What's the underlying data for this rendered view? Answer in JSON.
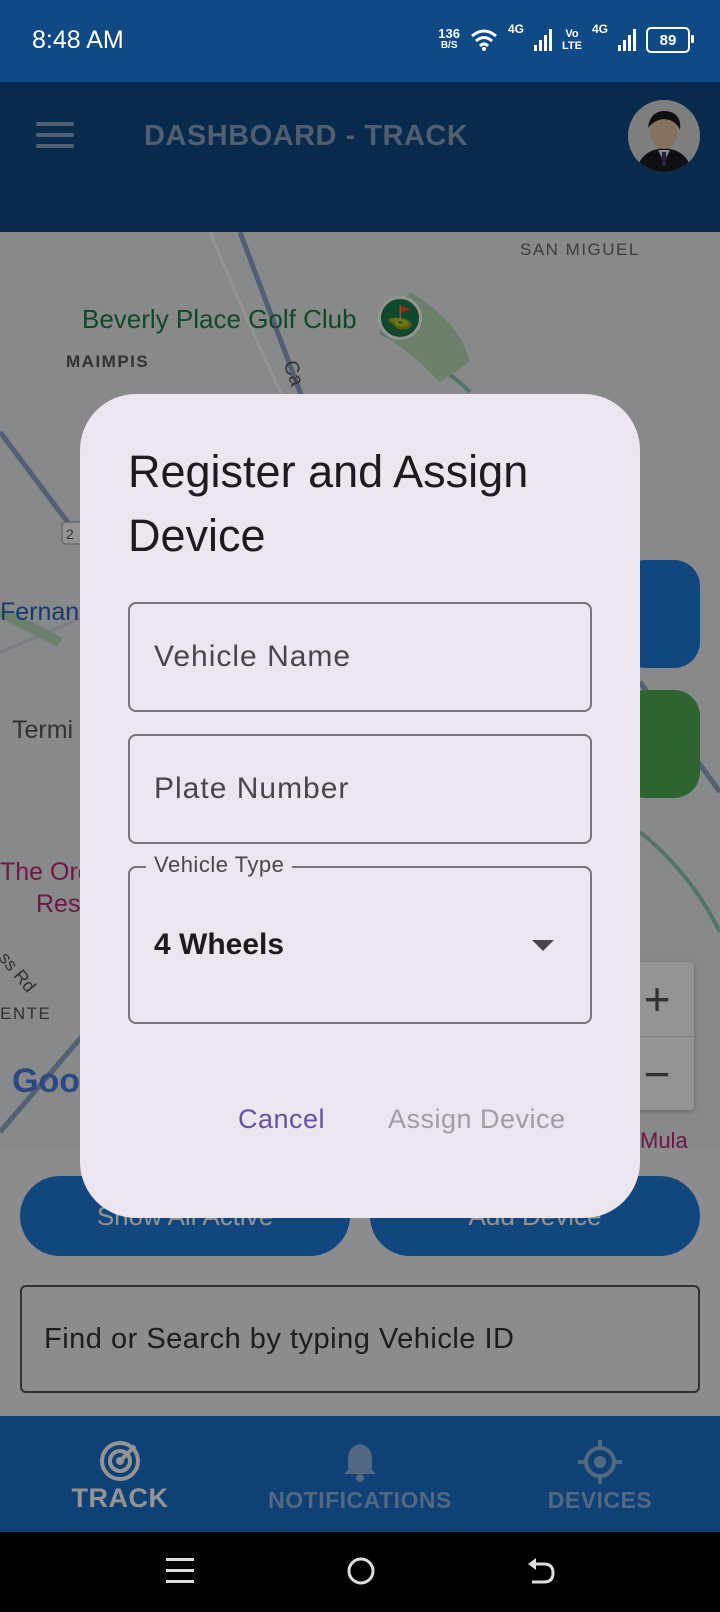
{
  "status_bar": {
    "time": "8:48 AM",
    "net_speed_value": "136",
    "net_speed_unit": "B/S",
    "network_1": "4G",
    "network_2_top": "Vo",
    "network_2_bottom": "LTE",
    "network_3": "4G",
    "battery": "89"
  },
  "app_bar": {
    "title": "DASHBOARD - TRACK"
  },
  "map": {
    "labels": {
      "san_miguel": "SAN MIGUEL",
      "golf_club": "Beverly Place Golf Club",
      "maimpis": "MAIMPIS",
      "fernan": "Fernan",
      "termi": "Termi",
      "the_orc": "The Orc",
      "res": "Res",
      "rd": "ss Rd",
      "ente": "ENTE",
      "google": "Goo",
      "mula": "Mula",
      "route": "2",
      "ca": "Ca"
    },
    "zoom_in": "+",
    "zoom_out": "−"
  },
  "controls": {
    "show_all_active": "Show All Active",
    "add_device": "Add Device",
    "search_placeholder": "Find or Search by typing Vehicle ID"
  },
  "bottom_nav": {
    "items": [
      {
        "label": "TRACK",
        "icon": "radar-icon",
        "active": true
      },
      {
        "label": "NOTIFICATIONS",
        "icon": "bell-icon",
        "active": false
      },
      {
        "label": "DEVICES",
        "icon": "locate-icon",
        "active": false
      }
    ]
  },
  "dialog": {
    "title": "Register and Assign Device",
    "vehicle_name_placeholder": "Vehicle Name",
    "plate_number_placeholder": "Plate Number",
    "vehicle_type_label": "Vehicle Type",
    "vehicle_type_value": "4 Wheels",
    "cancel": "Cancel",
    "assign": "Assign Device"
  },
  "colors": {
    "primary_dark": "#0f4a86",
    "primary": "#1e7ad6",
    "dialog_bg": "#ece6f0",
    "cancel_text": "#6750a4",
    "disabled_text": "#a09ca4",
    "fab_green": "#4caf50"
  }
}
